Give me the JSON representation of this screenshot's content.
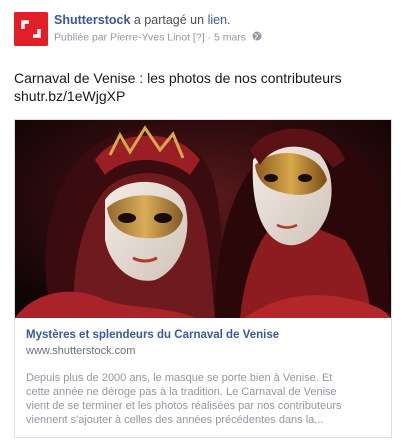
{
  "post": {
    "page_name": "Shutterstock",
    "action_text": " a partagé un ",
    "link_word": "lien",
    "action_end": ".",
    "published_by_label": "Publiée par ",
    "publisher": "Pierre-Yves Linot",
    "publisher_tag": " [?]",
    "separator": " · ",
    "date": "5 mars",
    "message_lines": [
      "Carnaval de Venise : les photos de nos contributeurs",
      "shutr.bz/1eWjgXP"
    ]
  },
  "link_card": {
    "title": "Mystères et splendeurs du Carnaval de Venise",
    "domain": "www.shutterstock.com",
    "description_lines": [
      "Depuis plus de 2000 ans, le masque se porte bien à Venise. Et",
      "cette année ne déroge pas à la tradition. Le Carnaval de Venise",
      "vient de se terminer et les photos réalisées par nos contributeurs",
      "viennent s'ajouter à celles des années précédentes dans la..."
    ]
  },
  "icons": {
    "logo": "shutterstock-logo-icon",
    "privacy": "globe-icon"
  },
  "colors": {
    "brand_red": "#e21f26",
    "link_blue": "#3b5998",
    "meta_gray": "#9197a3"
  }
}
